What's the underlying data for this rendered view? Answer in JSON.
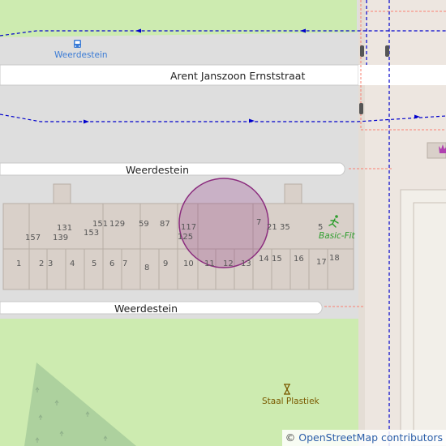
{
  "streets": {
    "main_road": "Arent Janszoon Ernststraat",
    "street_upper": "Weerdestein",
    "street_lower": "Weerdestein"
  },
  "pois": {
    "bus_stop": {
      "label": "Weerdestein",
      "icon": "bus-stop-icon",
      "color": "#3a7bd5"
    },
    "gym": {
      "label": "Basic-Fit",
      "icon": "running-person-icon",
      "color": "#2e9e2e"
    },
    "shop": {
      "label": "Staal Plastiek",
      "icon": "hourglass-icon",
      "color": "#7a5a00"
    },
    "area_icon": {
      "icon": "crown-icon",
      "color": "#b040b0"
    }
  },
  "house_numbers": {
    "n157": "157",
    "n139": "139",
    "n131": "131",
    "n153": "153",
    "n151": "151",
    "n129": "129",
    "n59": "59",
    "n87": "87",
    "n117": "117",
    "n125": "125",
    "n7": "7",
    "n21": "21",
    "n35": "35",
    "n5": "5",
    "n1": "1",
    "n2": "2",
    "n3": "3",
    "n4": "4",
    "n5b": "5",
    "n6": "6",
    "n7b": "7",
    "n8": "8",
    "n9": "9",
    "n10": "10",
    "n11": "11",
    "n12": "12",
    "n13": "13",
    "n14": "14",
    "n15": "15",
    "n16": "16",
    "n17": "17",
    "n18": "18"
  },
  "attribution": {
    "copyright": "©",
    "text": "OpenStreetMap contributors"
  },
  "colors": {
    "park": "#c8f0c0",
    "road": "#ffffff",
    "building": "#d9d0c9",
    "parking": "#dedede",
    "marker": "#8b2c7e",
    "bus_route": "#0000cc",
    "path": "#fa8072"
  }
}
